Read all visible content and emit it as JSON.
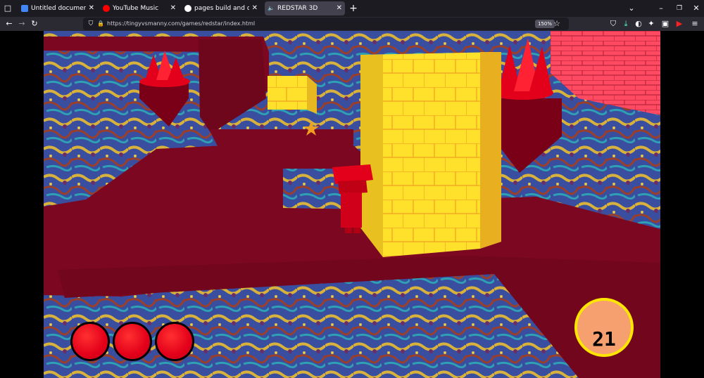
{
  "tabs": [
    {
      "title": "Untitled document - Google Do",
      "icon": "google-docs-icon",
      "color": "#4285f4"
    },
    {
      "title": "YouTube Music",
      "icon": "youtube-music-icon",
      "color": "#ff0000"
    },
    {
      "title": "pages build and deployment · t",
      "icon": "github-icon",
      "color": "#ffffff"
    },
    {
      "title": "REDSTAR 3D",
      "icon": "speaker-icon",
      "color": "#ffffff",
      "active": true
    }
  ],
  "navbar": {
    "url": "https://tingyvsmanny.com/games/redstar/index.html",
    "zoom": "150%"
  },
  "game": {
    "lives": 3,
    "score": "21"
  }
}
